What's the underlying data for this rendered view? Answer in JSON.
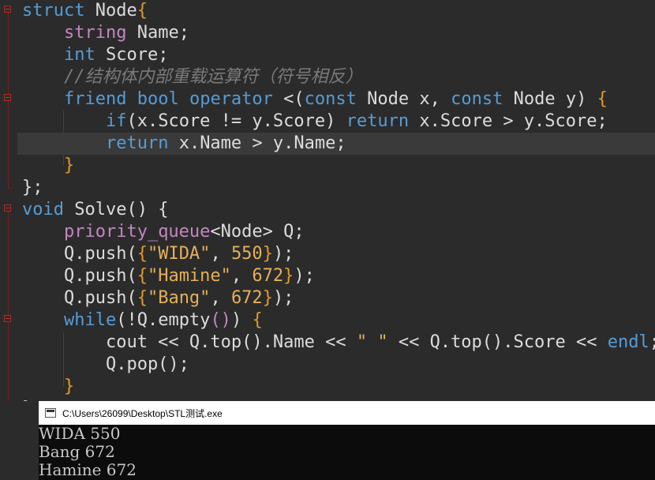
{
  "editor": {
    "lines": [
      [
        [
          "kw",
          "struct"
        ],
        [
          "id",
          " Node"
        ],
        [
          "br",
          "{"
        ]
      ],
      [
        [
          "id",
          "    "
        ],
        [
          "tpl",
          "string"
        ],
        [
          "id",
          " Name;"
        ]
      ],
      [
        [
          "id",
          "    "
        ],
        [
          "kw",
          "int"
        ],
        [
          "id",
          " Score;"
        ]
      ],
      [
        [
          "id",
          "    "
        ],
        [
          "cm",
          "//结构体内部重载运算符（符号相反）"
        ]
      ],
      [
        [
          "id",
          "    "
        ],
        [
          "kw",
          "friend"
        ],
        [
          "id",
          " "
        ],
        [
          "kw",
          "bool"
        ],
        [
          "id",
          " "
        ],
        [
          "kw",
          "operator"
        ],
        [
          "id",
          " <("
        ],
        [
          "kw",
          "const"
        ],
        [
          "id",
          " Node x, "
        ],
        [
          "kw",
          "const"
        ],
        [
          "id",
          " Node y) "
        ],
        [
          "br",
          "{"
        ]
      ],
      [
        [
          "id",
          "        "
        ],
        [
          "kw",
          "if"
        ],
        [
          "id",
          "(x.Score != y.Score) "
        ],
        [
          "kw",
          "return"
        ],
        [
          "id",
          " x.Score > y.Score;"
        ]
      ],
      [
        [
          "id",
          "        "
        ],
        [
          "kw",
          "return"
        ],
        [
          "id",
          " x.Name > y.Name;"
        ]
      ],
      [
        [
          "id",
          "    "
        ],
        [
          "br",
          "}"
        ]
      ],
      [
        [
          "id",
          "};"
        ]
      ],
      [
        [
          "kw",
          "void"
        ],
        [
          "id",
          " Solve() {"
        ]
      ],
      [
        [
          "id",
          "    "
        ],
        [
          "tpl",
          "priority_queue"
        ],
        [
          "id",
          "<Node> Q;"
        ]
      ],
      [
        [
          "id",
          "    Q.push("
        ],
        [
          "br",
          "{"
        ],
        [
          "str",
          "\"WIDA\""
        ],
        [
          "id",
          ", "
        ],
        [
          "num",
          "550"
        ],
        [
          "br",
          "}"
        ],
        [
          "id",
          ");"
        ]
      ],
      [
        [
          "id",
          "    Q.push("
        ],
        [
          "br",
          "{"
        ],
        [
          "str",
          "\"Hamine\""
        ],
        [
          "id",
          ", "
        ],
        [
          "num",
          "672"
        ],
        [
          "br",
          "}"
        ],
        [
          "id",
          ");"
        ]
      ],
      [
        [
          "id",
          "    Q.push("
        ],
        [
          "br",
          "{"
        ],
        [
          "str",
          "\"Bang\""
        ],
        [
          "id",
          ", "
        ],
        [
          "num",
          "672"
        ],
        [
          "br",
          "}"
        ],
        [
          "id",
          ");"
        ]
      ],
      [
        [
          "id",
          "    "
        ],
        [
          "kw",
          "while"
        ],
        [
          "id",
          "(!Q.empty"
        ],
        [
          "tpl",
          "()"
        ],
        [
          "id",
          ") "
        ],
        [
          "br",
          "{"
        ]
      ],
      [
        [
          "id",
          "        cout << Q.top().Name << "
        ],
        [
          "str",
          "\" \""
        ],
        [
          "id",
          " << Q.top().Score << "
        ],
        [
          "kw",
          "endl"
        ],
        [
          "id",
          ";"
        ]
      ],
      [
        [
          "id",
          "        Q.pop();"
        ]
      ],
      [
        [
          "id",
          "    "
        ],
        [
          "br",
          "}"
        ]
      ],
      [
        [
          "id",
          "}"
        ]
      ]
    ],
    "current_line_index": 6
  },
  "console": {
    "title": "C:\\Users\\26099\\Desktop\\STL测试.exe",
    "output": [
      "WIDA 550",
      "Bang 672",
      "Hamine 672"
    ]
  }
}
